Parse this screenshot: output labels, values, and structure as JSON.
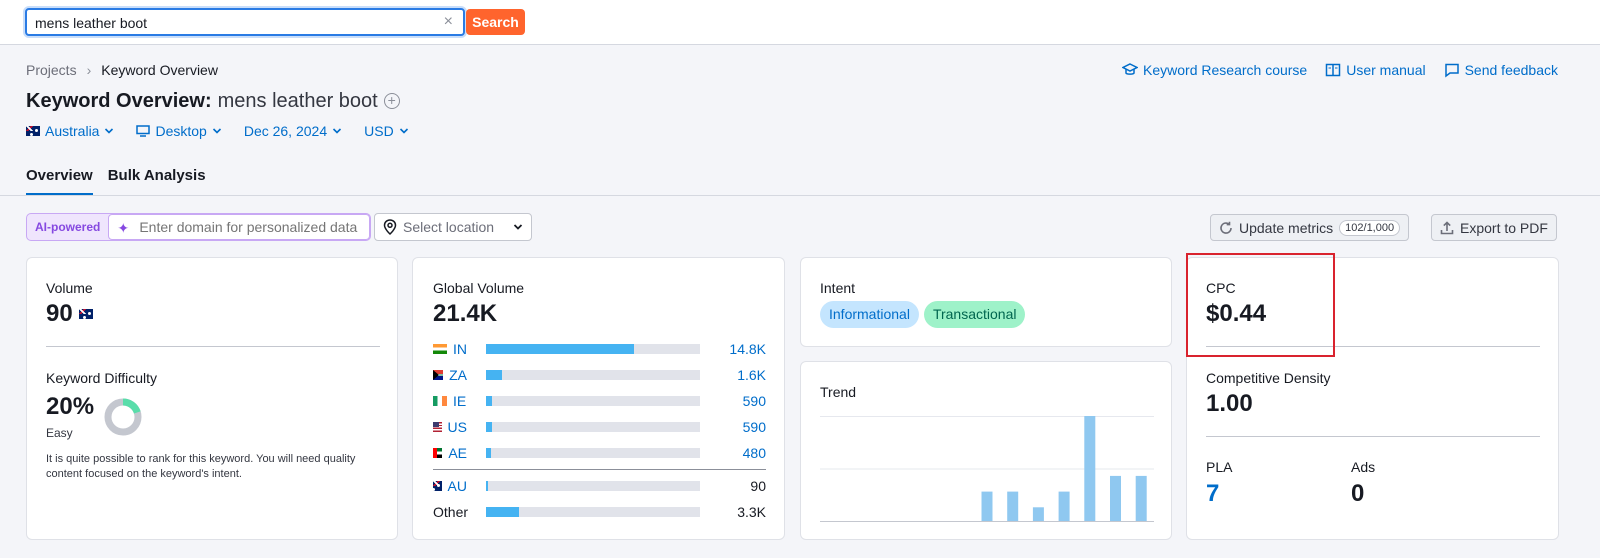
{
  "search": {
    "value": "mens leather boot",
    "clear": "×",
    "button": "Search"
  },
  "breadcrumb": {
    "root": "Projects",
    "separator": "›",
    "current": "Keyword Overview"
  },
  "toplinks": {
    "course": "Keyword Research course",
    "manual": "User manual",
    "feedback": "Send feedback"
  },
  "title": {
    "prefix": "Keyword Overview:",
    "keyword": "mens leather boot",
    "plus": "+"
  },
  "filters": {
    "country": "Australia",
    "device": "Desktop",
    "date": "Dec 26, 2024",
    "currency": "USD"
  },
  "tabs": [
    "Overview",
    "Bulk Analysis"
  ],
  "toolbar": {
    "ai_label": "AI-powered",
    "ai_placeholder": "Enter domain for personalized data",
    "location_placeholder": "Select location",
    "update": "Update metrics",
    "update_count": "102/1,000",
    "export": "Export to PDF"
  },
  "volume": {
    "label": "Volume",
    "value": "90"
  },
  "kd": {
    "label": "Keyword Difficulty",
    "value": "20%",
    "level": "Easy",
    "percent": 20,
    "description": "It is quite possible to rank for this keyword. You will need quality content focused on the keyword's intent.",
    "color": "#59ddaa"
  },
  "global_volume": {
    "label": "Global Volume",
    "value": "21.4K",
    "rows": [
      {
        "code": "IN",
        "flag": "flag-in-icon",
        "value": "14.8K",
        "share": 0.69
      },
      {
        "code": "ZA",
        "flag": "flag-za-icon",
        "value": "1.6K",
        "share": 0.075
      },
      {
        "code": "IE",
        "flag": "flag-ie-icon",
        "value": "590",
        "share": 0.03
      },
      {
        "code": "US",
        "flag": "flag-us-icon",
        "value": "590",
        "share": 0.03
      },
      {
        "code": "AE",
        "flag": "flag-ae-icon",
        "value": "480",
        "share": 0.025
      }
    ],
    "au": {
      "code": "AU",
      "value": "90",
      "share": 0.01
    },
    "other": {
      "code": "Other",
      "value": "3.3K",
      "share": 0.155
    }
  },
  "intent": {
    "label": "Intent",
    "chips": [
      "Informational",
      "Transactional"
    ]
  },
  "trend": {
    "label": "Trend",
    "values": [
      0,
      0,
      0,
      0,
      0,
      0,
      28,
      28,
      13,
      28,
      100,
      43,
      43
    ]
  },
  "cpc": {
    "label": "CPC",
    "value": "$0.44"
  },
  "density": {
    "label": "Competitive Density",
    "value": "1.00"
  },
  "pla": {
    "label": "PLA",
    "value": "7"
  },
  "ads": {
    "label": "Ads",
    "value": "0"
  },
  "colors": {
    "accent": "#006dca",
    "search_button": "#ff642d",
    "bar": "#45b3f2",
    "trend_bar": "#8fc8f0",
    "highlight": "#d9232e"
  }
}
